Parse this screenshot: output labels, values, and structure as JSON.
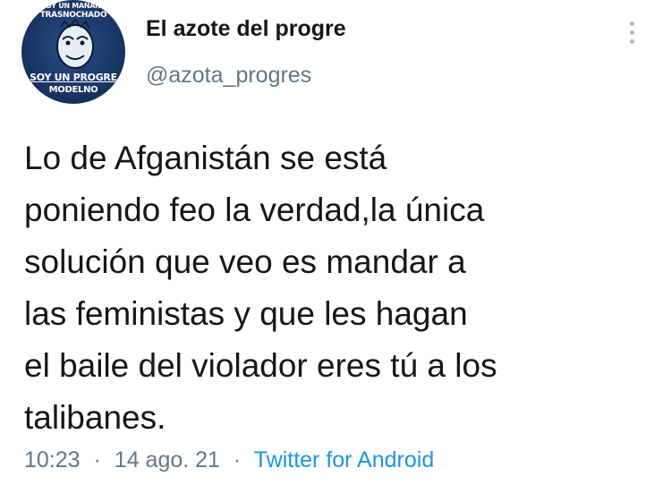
{
  "account": {
    "display_name": "El azote del progre",
    "handle": "@azota_progres",
    "avatar": {
      "line1": "SOY UN MAÑANA",
      "line2": "TRASNOCHADO",
      "line3": "SOY UN PROGRE",
      "line4": "MODELNO"
    }
  },
  "tweet": {
    "lines": [
      "Lo de Afganistán se está",
      "poniendo feo la verdad,la única",
      "solución que veo es mandar a",
      "las feministas y que les hagan",
      "el baile del violador eres tú a los",
      "talibanes."
    ]
  },
  "meta": {
    "time": "10:23",
    "date": "14 ago. 21",
    "separator": "·",
    "source": "Twitter for Android"
  },
  "colors": {
    "text": "#14171a",
    "secondary": "#657786",
    "link": "#1b95e0"
  }
}
